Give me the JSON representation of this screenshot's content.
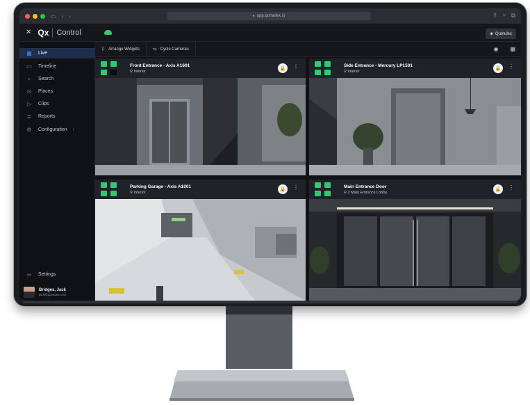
{
  "browser": {
    "url": "app.qumulex.io",
    "url_lock_icon": "lock-icon"
  },
  "app": {
    "close_icon": "close-icon",
    "brand_logo": "Qx",
    "brand_name": "Control",
    "status_icon": "cloud-icon",
    "org_button_label": "Qumulex"
  },
  "sidebar": {
    "items": [
      {
        "label": "Live",
        "icon": "live-grid-icon",
        "active": true
      },
      {
        "label": "Timeline",
        "icon": "timeline-icon",
        "active": false
      },
      {
        "label": "Search",
        "icon": "search-icon",
        "active": false
      },
      {
        "label": "Places",
        "icon": "map-pin-icon",
        "active": false
      },
      {
        "label": "Clips",
        "icon": "clip-icon",
        "active": false
      },
      {
        "label": "Reports",
        "icon": "reports-icon",
        "active": false
      },
      {
        "label": "Configuration",
        "icon": "gear-icon",
        "active": false,
        "has_submenu": true
      }
    ],
    "settings_label": "Settings",
    "user": {
      "name": "Bridges, Jack",
      "email": "jack@qumulex.com"
    }
  },
  "toolbar": {
    "arrange_label": "Arrange Widgets",
    "cycle_label": "Cycle Cameras",
    "view_icon": "eye-icon",
    "layout_icon": "layout-grid-icon"
  },
  "cameras": [
    {
      "title": "Front Entrance - Axis A1601",
      "location": "Interior",
      "locked": true
    },
    {
      "title": "Side Entrance - Mercury LP1501",
      "location": "Interior",
      "locked": true
    },
    {
      "title": "Parking Garage - Axis A1001",
      "location": "Interior",
      "locked": true
    },
    {
      "title": "Main Entrance Door",
      "location": "2 Main Entrance Lobby",
      "locked": true
    }
  ],
  "colors": {
    "accent": "#3c8cff",
    "status_ok": "#2ecc71",
    "background": "#101216"
  }
}
